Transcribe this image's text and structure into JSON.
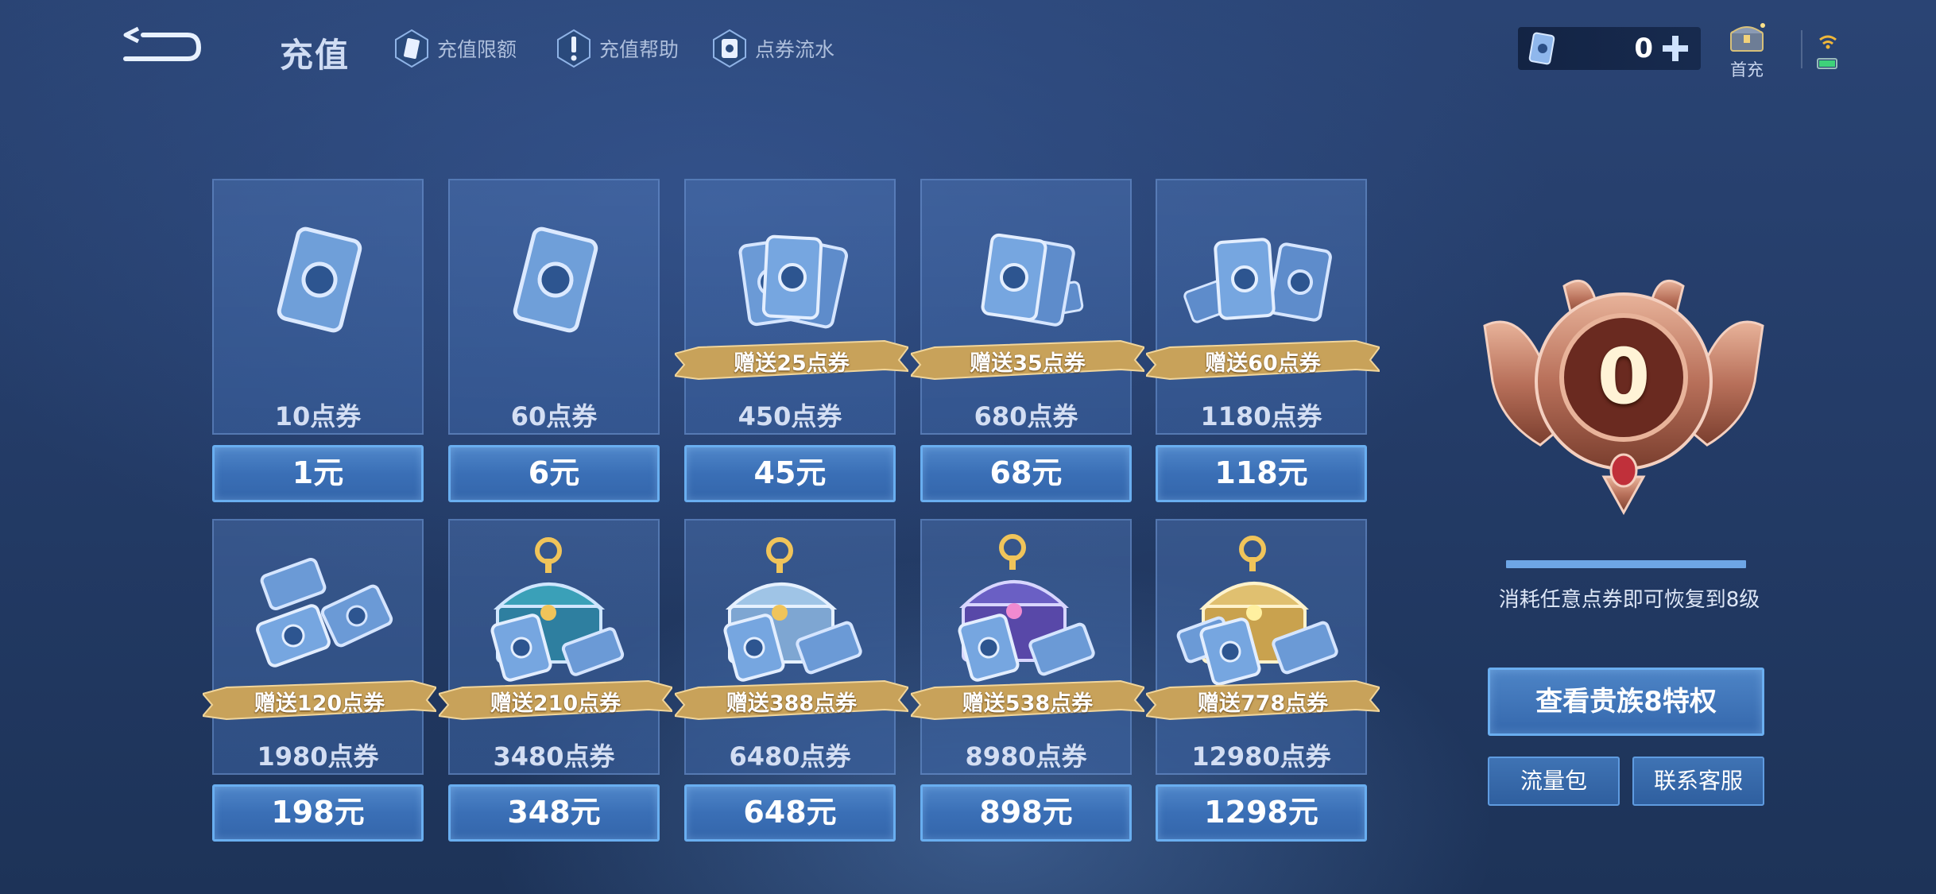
{
  "header": {
    "title": "充值",
    "links": [
      {
        "label": "充值限额",
        "icon": "card-icon"
      },
      {
        "label": "充值帮助",
        "icon": "exclamation-icon"
      },
      {
        "label": "点券流水",
        "icon": "coupon-icon"
      }
    ]
  },
  "balance": {
    "value": "0",
    "icon": "coupon-icon"
  },
  "first_charge": {
    "label": "首充",
    "icon": "chest-icon"
  },
  "products": [
    {
      "amount": "10点券",
      "price": "1元",
      "bonus": "",
      "art": "single-card"
    },
    {
      "amount": "60点券",
      "price": "6元",
      "bonus": "",
      "art": "single-card"
    },
    {
      "amount": "450点券",
      "price": "45元",
      "bonus": "赠送25点券",
      "art": "card-stack-small"
    },
    {
      "amount": "680点券",
      "price": "68元",
      "bonus": "赠送35点券",
      "art": "card-stack-small"
    },
    {
      "amount": "1180点券",
      "price": "118元",
      "bonus": "赠送60点券",
      "art": "card-stack-medium"
    },
    {
      "amount": "1980点券",
      "price": "198元",
      "bonus": "赠送120点券",
      "art": "card-stack-large"
    },
    {
      "amount": "3480点券",
      "price": "348元",
      "bonus": "赠送210点券",
      "art": "chest-teal"
    },
    {
      "amount": "6480点券",
      "price": "648元",
      "bonus": "赠送388点券",
      "art": "chest-silver"
    },
    {
      "amount": "8980点券",
      "price": "898元",
      "bonus": "赠送538点券",
      "art": "chest-purple"
    },
    {
      "amount": "12980点券",
      "price": "1298元",
      "bonus": "赠送778点券",
      "art": "chest-gold"
    }
  ],
  "noble": {
    "level": "0",
    "hint": "消耗任意点券即可恢复到8级",
    "view_button": "查看贵族8特权"
  },
  "bottom_buttons": {
    "data_pack": "流量包",
    "support": "联系客服"
  },
  "colors": {
    "accent": "#69aef0",
    "bonus_ribbon": "#c8a25a",
    "badge": "#b8705a"
  }
}
